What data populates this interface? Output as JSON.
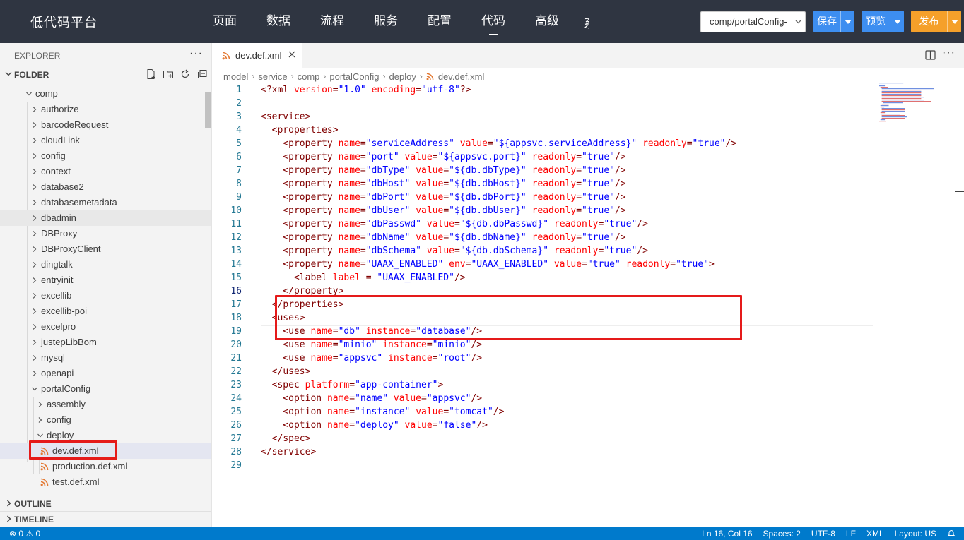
{
  "app": {
    "title": "低代码平台"
  },
  "nav": {
    "items": [
      {
        "label": "页面"
      },
      {
        "label": "数据"
      },
      {
        "label": "流程"
      },
      {
        "label": "服务"
      },
      {
        "label": "配置"
      },
      {
        "label": "代码",
        "active": true
      },
      {
        "label": "高级"
      }
    ],
    "overflow_label": "系统"
  },
  "toolbar": {
    "branch_value": "comp/portalConfig-",
    "save_label": "保存",
    "preview_label": "预览",
    "publish_label": "发布"
  },
  "sidebar": {
    "explorer_title": "EXPLORER",
    "more_label": "···",
    "folder_title": "FOLDER",
    "tree": [
      {
        "label": "comp",
        "depth": 0,
        "expanded": true
      },
      {
        "label": "authorize",
        "depth": 1
      },
      {
        "label": "barcodeRequest",
        "depth": 1
      },
      {
        "label": "cloudLink",
        "depth": 1
      },
      {
        "label": "config",
        "depth": 1
      },
      {
        "label": "context",
        "depth": 1
      },
      {
        "label": "database2",
        "depth": 1
      },
      {
        "label": "databasemetadata",
        "depth": 1
      },
      {
        "label": "dbadmin",
        "depth": 1,
        "hover": true
      },
      {
        "label": "DBProxy",
        "depth": 1
      },
      {
        "label": "DBProxyClient",
        "depth": 1
      },
      {
        "label": "dingtalk",
        "depth": 1
      },
      {
        "label": "entryinit",
        "depth": 1
      },
      {
        "label": "excellib",
        "depth": 1
      },
      {
        "label": "excellib-poi",
        "depth": 1
      },
      {
        "label": "excelpro",
        "depth": 1
      },
      {
        "label": "justepLibBom",
        "depth": 1
      },
      {
        "label": "mysql",
        "depth": 1
      },
      {
        "label": "openapi",
        "depth": 1
      },
      {
        "label": "portalConfig",
        "depth": 1,
        "expanded": true
      },
      {
        "label": "assembly",
        "depth": 2
      },
      {
        "label": "config",
        "depth": 2
      },
      {
        "label": "deploy",
        "depth": 2,
        "expanded": true
      },
      {
        "label": "dev.def.xml",
        "depth": 3,
        "file": true,
        "selected": true
      },
      {
        "label": "production.def.xml",
        "depth": 3,
        "file": true
      },
      {
        "label": "test.def.xml",
        "depth": 3,
        "file": true
      }
    ],
    "outline_label": "OUTLINE",
    "timeline_label": "TIMELINE"
  },
  "editor": {
    "tab_label": "dev.def.xml",
    "breadcrumbs": [
      "model",
      "service",
      "comp",
      "portalConfig",
      "deploy",
      "dev.def.xml"
    ],
    "active_line": 16,
    "lines": [
      "<?xml version=\"1.0\" encoding=\"utf-8\"?>",
      "",
      "<service>",
      "  <properties>",
      "    <property name=\"serviceAddress\" value=\"${appsvc.serviceAddress}\" readonly=\"true\"/>",
      "    <property name=\"port\" value=\"${appsvc.port}\" readonly=\"true\"/>",
      "    <property name=\"dbType\" value=\"${db.dbType}\" readonly=\"true\"/>",
      "    <property name=\"dbHost\" value=\"${db.dbHost}\" readonly=\"true\"/>",
      "    <property name=\"dbPort\" value=\"${db.dbPort}\" readonly=\"true\"/>",
      "    <property name=\"dbUser\" value=\"${db.dbUser}\" readonly=\"true\"/>",
      "    <property name=\"dbPasswd\" value=\"${db.dbPasswd}\" readonly=\"true\"/>",
      "    <property name=\"dbName\" value=\"${db.dbName}\" readonly=\"true\"/>",
      "    <property name=\"dbSchema\" value=\"${db.dbSchema}\" readonly=\"true\"/>",
      "    <property name=\"UAAX_ENABLED\" env=\"UAAX_ENABLED\" value=\"true\" readonly=\"true\">",
      "      <label label = \"UAAX_ENABLED\"/>",
      "    </property>",
      "  </properties>",
      "  <uses>",
      "    <use name=\"db\" instance=\"database\"/>",
      "    <use name=\"minio\" instance=\"minio\"/>",
      "    <use name=\"appsvc\" instance=\"root\"/>",
      "  </uses>",
      "  <spec platform=\"app-container\">",
      "    <option name=\"name\" value=\"appsvc\"/>",
      "    <option name=\"instance\" value=\"tomcat\"/>",
      "    <option name=\"deploy\" value=\"false\"/>",
      "  </spec>",
      "</service>",
      ""
    ]
  },
  "statusbar": {
    "problems": "⊗ 0 ⚠ 0",
    "position": "Ln 16, Col 16",
    "spaces": "Spaces: 2",
    "encoding": "UTF-8",
    "eol": "LF",
    "language": "XML",
    "layout": "Layout: US"
  },
  "colors": {
    "topbar_bg": "#2f3541",
    "primary_button": "#3d8ef0",
    "publish_button": "#f5a02a",
    "status_bar": "#007acc",
    "highlight_border": "#e51a1a",
    "xml_icon": "#e37933"
  }
}
